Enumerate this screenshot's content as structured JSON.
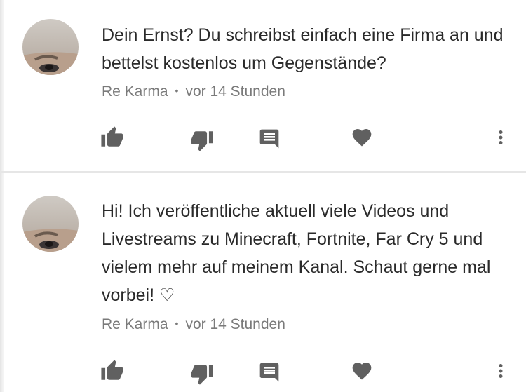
{
  "comments": [
    {
      "text": "Dein Ernst? Du schreibst einfach eine Firma an und bettelst kostenlos um Gegenstände?",
      "author": "Re Karma",
      "separator": "•",
      "time": "vor 14 Stunden"
    },
    {
      "text": "Hi! Ich veröffentliche aktuell viele Videos und Livestreams zu Minecraft, Fortnite, Far Cry 5 und vielem mehr auf meinem Kanal. Schaut gerne mal vorbei! ♡",
      "author": "Re Karma",
      "separator": "•",
      "time": "vor 14 Stunden"
    }
  ],
  "icons": {
    "like": "thumbs-up-icon",
    "dislike": "thumbs-down-icon",
    "reply": "comment-icon",
    "heart": "heart-icon",
    "more": "more-vert-icon"
  },
  "colors": {
    "text": "#2a2a2a",
    "meta": "#7a7a7a",
    "icon": "#606060",
    "divider": "#e6e6e6"
  }
}
